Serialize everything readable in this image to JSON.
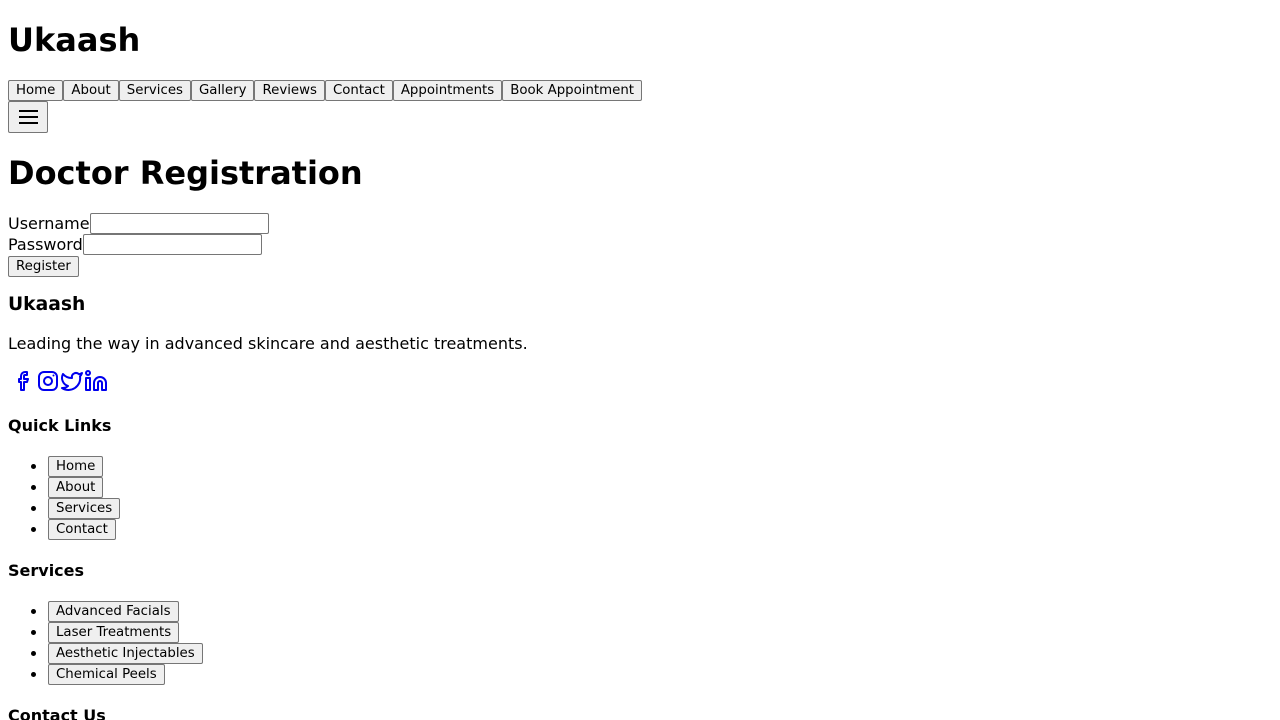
{
  "site": {
    "title": "Ukaash"
  },
  "nav": {
    "items": [
      "Home",
      "About",
      "Services",
      "Gallery",
      "Reviews",
      "Contact",
      "Appointments",
      "Book Appointment"
    ],
    "menu_icon": "hamburger-menu-icon"
  },
  "registration": {
    "heading": "Doctor Registration",
    "username_label": "Username",
    "username_value": "",
    "password_label": "Password",
    "password_value": "",
    "submit_label": "Register"
  },
  "footer": {
    "brand": "Ukaash",
    "tagline": "Leading the way in advanced skincare and aesthetic treatments.",
    "social_icons": [
      "facebook-icon",
      "instagram-icon",
      "twitter-icon",
      "linkedin-icon"
    ],
    "social_color": "#0000ee",
    "quick_links": {
      "title": "Quick Links",
      "items": [
        "Home",
        "About",
        "Services",
        "Contact"
      ]
    },
    "services": {
      "title": "Services",
      "items": [
        "Advanced Facials",
        "Laser Treatments",
        "Aesthetic Injectables",
        "Chemical Peels"
      ]
    },
    "contact": {
      "title": "Contact Us"
    }
  }
}
